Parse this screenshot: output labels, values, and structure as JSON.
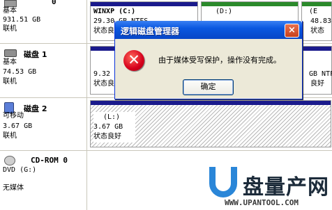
{
  "disks": [
    {
      "title": "0",
      "type": "基本",
      "size": "931.51 GB",
      "status": "联机"
    },
    {
      "title": "磁盘 1",
      "type": "基本",
      "size": "74.53 GB",
      "status": "联机"
    },
    {
      "title": "磁盘 2",
      "type": "可移动",
      "size": "3.67 GB",
      "status": "联机"
    },
    {
      "title": "CD-ROM 0",
      "type": "DVD (G:)",
      "size": "",
      "status": "无媒体"
    }
  ],
  "partitions": {
    "d0p1": {
      "name": "WINXP  (C:)",
      "info": "29.30 GB NTFS",
      "state": "状态良"
    },
    "d0p2": {
      "name": "(D:)"
    },
    "d0p3": {
      "name": "(E",
      "info": "48.83",
      "state": "状态"
    },
    "d1p1": {
      "info": "9.32",
      "state": "状态良"
    },
    "d1p3": {
      "info": "GB NTF",
      "state": "良好"
    },
    "d2p1": {
      "name": "(L:)",
      "info": "3.67 GB",
      "state": "状态良好"
    }
  },
  "dialog": {
    "title": "逻辑磁盘管理器",
    "message": "由于媒体受写保护，操作没有完成。",
    "ok": "确定",
    "close": "×",
    "error_glyph": "✕"
  },
  "watermark": {
    "brand": "盘量产网",
    "url": "WWW.UPANTOOL.COM"
  }
}
